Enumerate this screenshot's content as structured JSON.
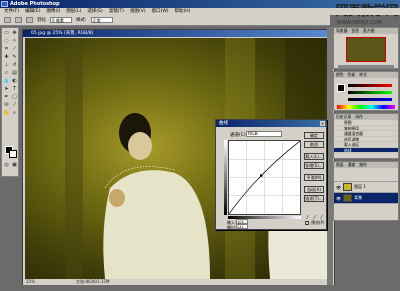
{
  "app": {
    "title": "Adobe Photoshop"
  },
  "watermark": {
    "text": "网页教学网",
    "url": "WWW.WEBJX.COM"
  },
  "menu": [
    "文件(F)",
    "编辑(E)",
    "图像(I)",
    "图层(L)",
    "选择(S)",
    "滤镜(T)",
    "视图(V)",
    "窗口(W)",
    "帮助(H)"
  ],
  "options": {
    "feather_label": "羽化",
    "feather_value": "0 像素",
    "style_label": "样式:",
    "style_value": "正常"
  },
  "document": {
    "title": "05.jpg @ 25% (背景, RGB/8)",
    "zoom": "25%",
    "status": "文档:861K/1.37M"
  },
  "curves": {
    "title": "曲线",
    "channel_label": "通道(C):",
    "channel_value": "RGB",
    "buttons": [
      "确定",
      "取消",
      "载入(L)...",
      "存储(S)...",
      "平滑(M)",
      "自动(A)",
      "选项(T)..."
    ],
    "input_label": "输入:",
    "input_value": "104",
    "output_label": "输出:",
    "output_value": "141",
    "preview_label": "预览(P)",
    "point": {
      "input": 104,
      "output": 141
    }
  },
  "panels": {
    "navigator_tabs": [
      "导航器",
      "信息",
      "直方图"
    ],
    "color_tabs": [
      "颜色",
      "色板",
      "样式"
    ],
    "history_tabs": [
      "历史记录",
      "动作"
    ],
    "history_items": [
      "原图",
      "复制图层",
      "通道混合器",
      "选区调整",
      "载入选区",
      "曲线"
    ],
    "layers_tabs": [
      "图层",
      "通道",
      "路径"
    ],
    "layers": [
      {
        "name": "图层 1",
        "color": "#c8b828"
      },
      {
        "name": "背景",
        "color": "#6a6418"
      }
    ]
  },
  "colors": {
    "titlebar": "#0a246a",
    "chrome": "#d4d0c8",
    "selection": "#0a246a"
  }
}
